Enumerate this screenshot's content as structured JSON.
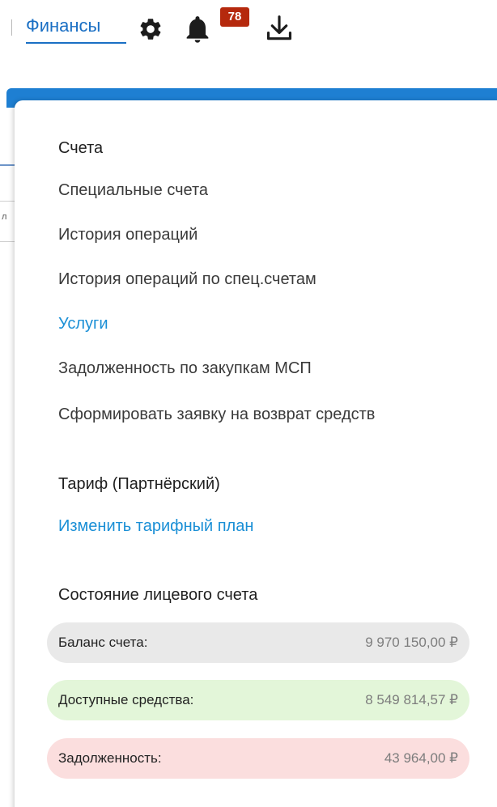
{
  "topbar": {
    "finance_label": "Финансы",
    "notifications_count": "78",
    "icons": [
      "gear-icon",
      "bell-icon",
      "download-icon"
    ]
  },
  "menu": {
    "accounts_heading": "Счета",
    "items": [
      "Специальные счета",
      "История операций",
      "История операций по спец.счетам",
      "Услуги",
      "Задолженность по закупкам МСП",
      "Сформировать заявку на возврат средств"
    ],
    "active_item": "Услуги",
    "tariff_heading": "Тариф (Партнёрский)",
    "change_tariff_link": "Изменить тарифный план",
    "account_state_heading": "Состояние лицевого счета"
  },
  "account": {
    "balance_label": "Баланс счета:",
    "balance_value": "9 970 150,00 ₽",
    "available_label": "Доступные средства:",
    "available_value": "8 549 814,57 ₽",
    "debt_label": "Задолженность:",
    "debt_value": "43 964,00 ₽"
  },
  "colors": {
    "link": "#1a8fd6",
    "badge": "#b5290d",
    "header_blue": "#1e7fd2",
    "balance_bg": "#e9e9e9",
    "available_bg": "#e3f6d9",
    "debt_bg": "#fbdede"
  }
}
